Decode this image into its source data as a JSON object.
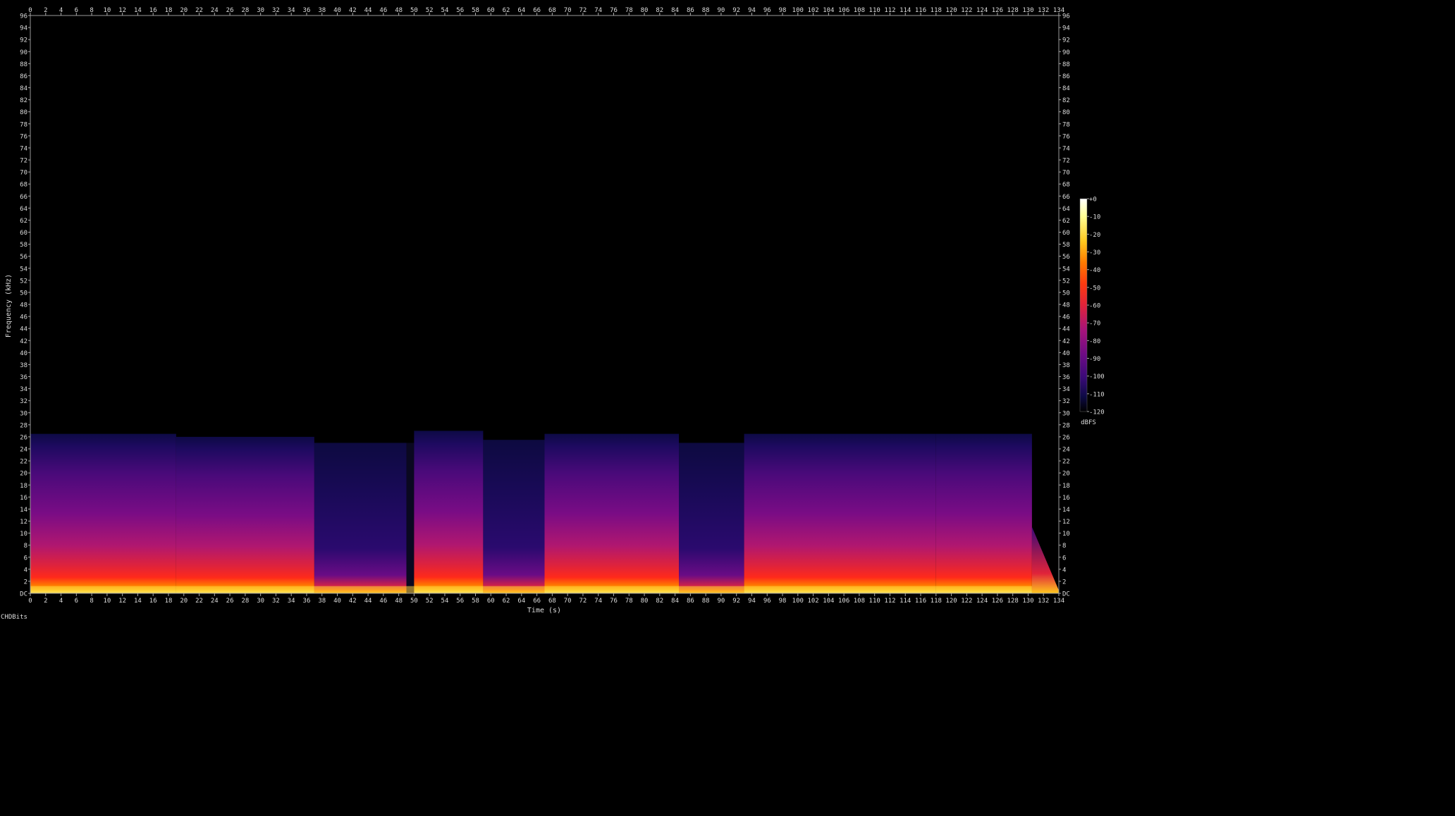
{
  "app_label": "CHDBits",
  "chart_data": {
    "type": "heatmap",
    "xlabel": "Time (s)",
    "ylabel": "Frequency (kHz)",
    "xlim": [
      0,
      134
    ],
    "ylim": [
      0,
      96
    ],
    "x_ticks": [
      0,
      2,
      4,
      6,
      8,
      10,
      12,
      14,
      16,
      18,
      20,
      22,
      24,
      26,
      28,
      30,
      32,
      34,
      36,
      38,
      40,
      42,
      44,
      46,
      48,
      50,
      52,
      54,
      56,
      58,
      60,
      62,
      64,
      66,
      68,
      70,
      72,
      74,
      76,
      78,
      80,
      82,
      84,
      86,
      88,
      90,
      92,
      94,
      96,
      98,
      100,
      102,
      104,
      106,
      108,
      110,
      112,
      114,
      116,
      118,
      120,
      122,
      124,
      126,
      128,
      130,
      132,
      134
    ],
    "y_ticks": [
      "DC",
      "2",
      "4",
      "6",
      "8",
      "10",
      "12",
      "14",
      "16",
      "18",
      "20",
      "22",
      "24",
      "26",
      "28",
      "30",
      "32",
      "34",
      "36",
      "38",
      "40",
      "42",
      "44",
      "46",
      "48",
      "50",
      "52",
      "54",
      "56",
      "58",
      "60",
      "62",
      "64",
      "66",
      "68",
      "70",
      "72",
      "74",
      "76",
      "78",
      "80",
      "82",
      "84",
      "86",
      "88",
      "90",
      "92",
      "94",
      "96"
    ],
    "colorbar": {
      "label": "dBFS",
      "range": [
        -120,
        0
      ],
      "ticks": [
        "+0",
        "-10",
        "-20",
        "-30",
        "-40",
        "-50",
        "-60",
        "-70",
        "-80",
        "-90",
        "-100",
        "-110",
        "-120"
      ],
      "colors": [
        "#000000",
        "#0d0a45",
        "#3a0a78",
        "#6a0b85",
        "#a5137c",
        "#e0233a",
        "#ff3a10",
        "#ff7a00",
        "#ffc81e",
        "#ffff96",
        "#ffffff"
      ]
    },
    "segments": [
      {
        "start": 0,
        "end": 19,
        "max_khz": 26.5,
        "level": "loud"
      },
      {
        "start": 19,
        "end": 37,
        "max_khz": 26.0,
        "level": "loud"
      },
      {
        "start": 37,
        "end": 49,
        "max_khz": 25.0,
        "level": "quiet"
      },
      {
        "start": 49,
        "end": 50,
        "max_khz": 25.0,
        "level": "silent"
      },
      {
        "start": 50,
        "end": 59,
        "max_khz": 27.0,
        "level": "loud"
      },
      {
        "start": 59,
        "end": 67,
        "max_khz": 25.5,
        "level": "quiet"
      },
      {
        "start": 67,
        "end": 84.5,
        "max_khz": 26.5,
        "level": "loud"
      },
      {
        "start": 84.5,
        "end": 93,
        "max_khz": 25.0,
        "level": "quiet"
      },
      {
        "start": 93,
        "end": 118,
        "max_khz": 26.5,
        "level": "loud"
      },
      {
        "start": 118,
        "end": 130.5,
        "max_khz": 26.5,
        "level": "loud"
      },
      {
        "start": 130.5,
        "end": 134,
        "max_khz": 4.0,
        "level": "fade"
      }
    ]
  }
}
